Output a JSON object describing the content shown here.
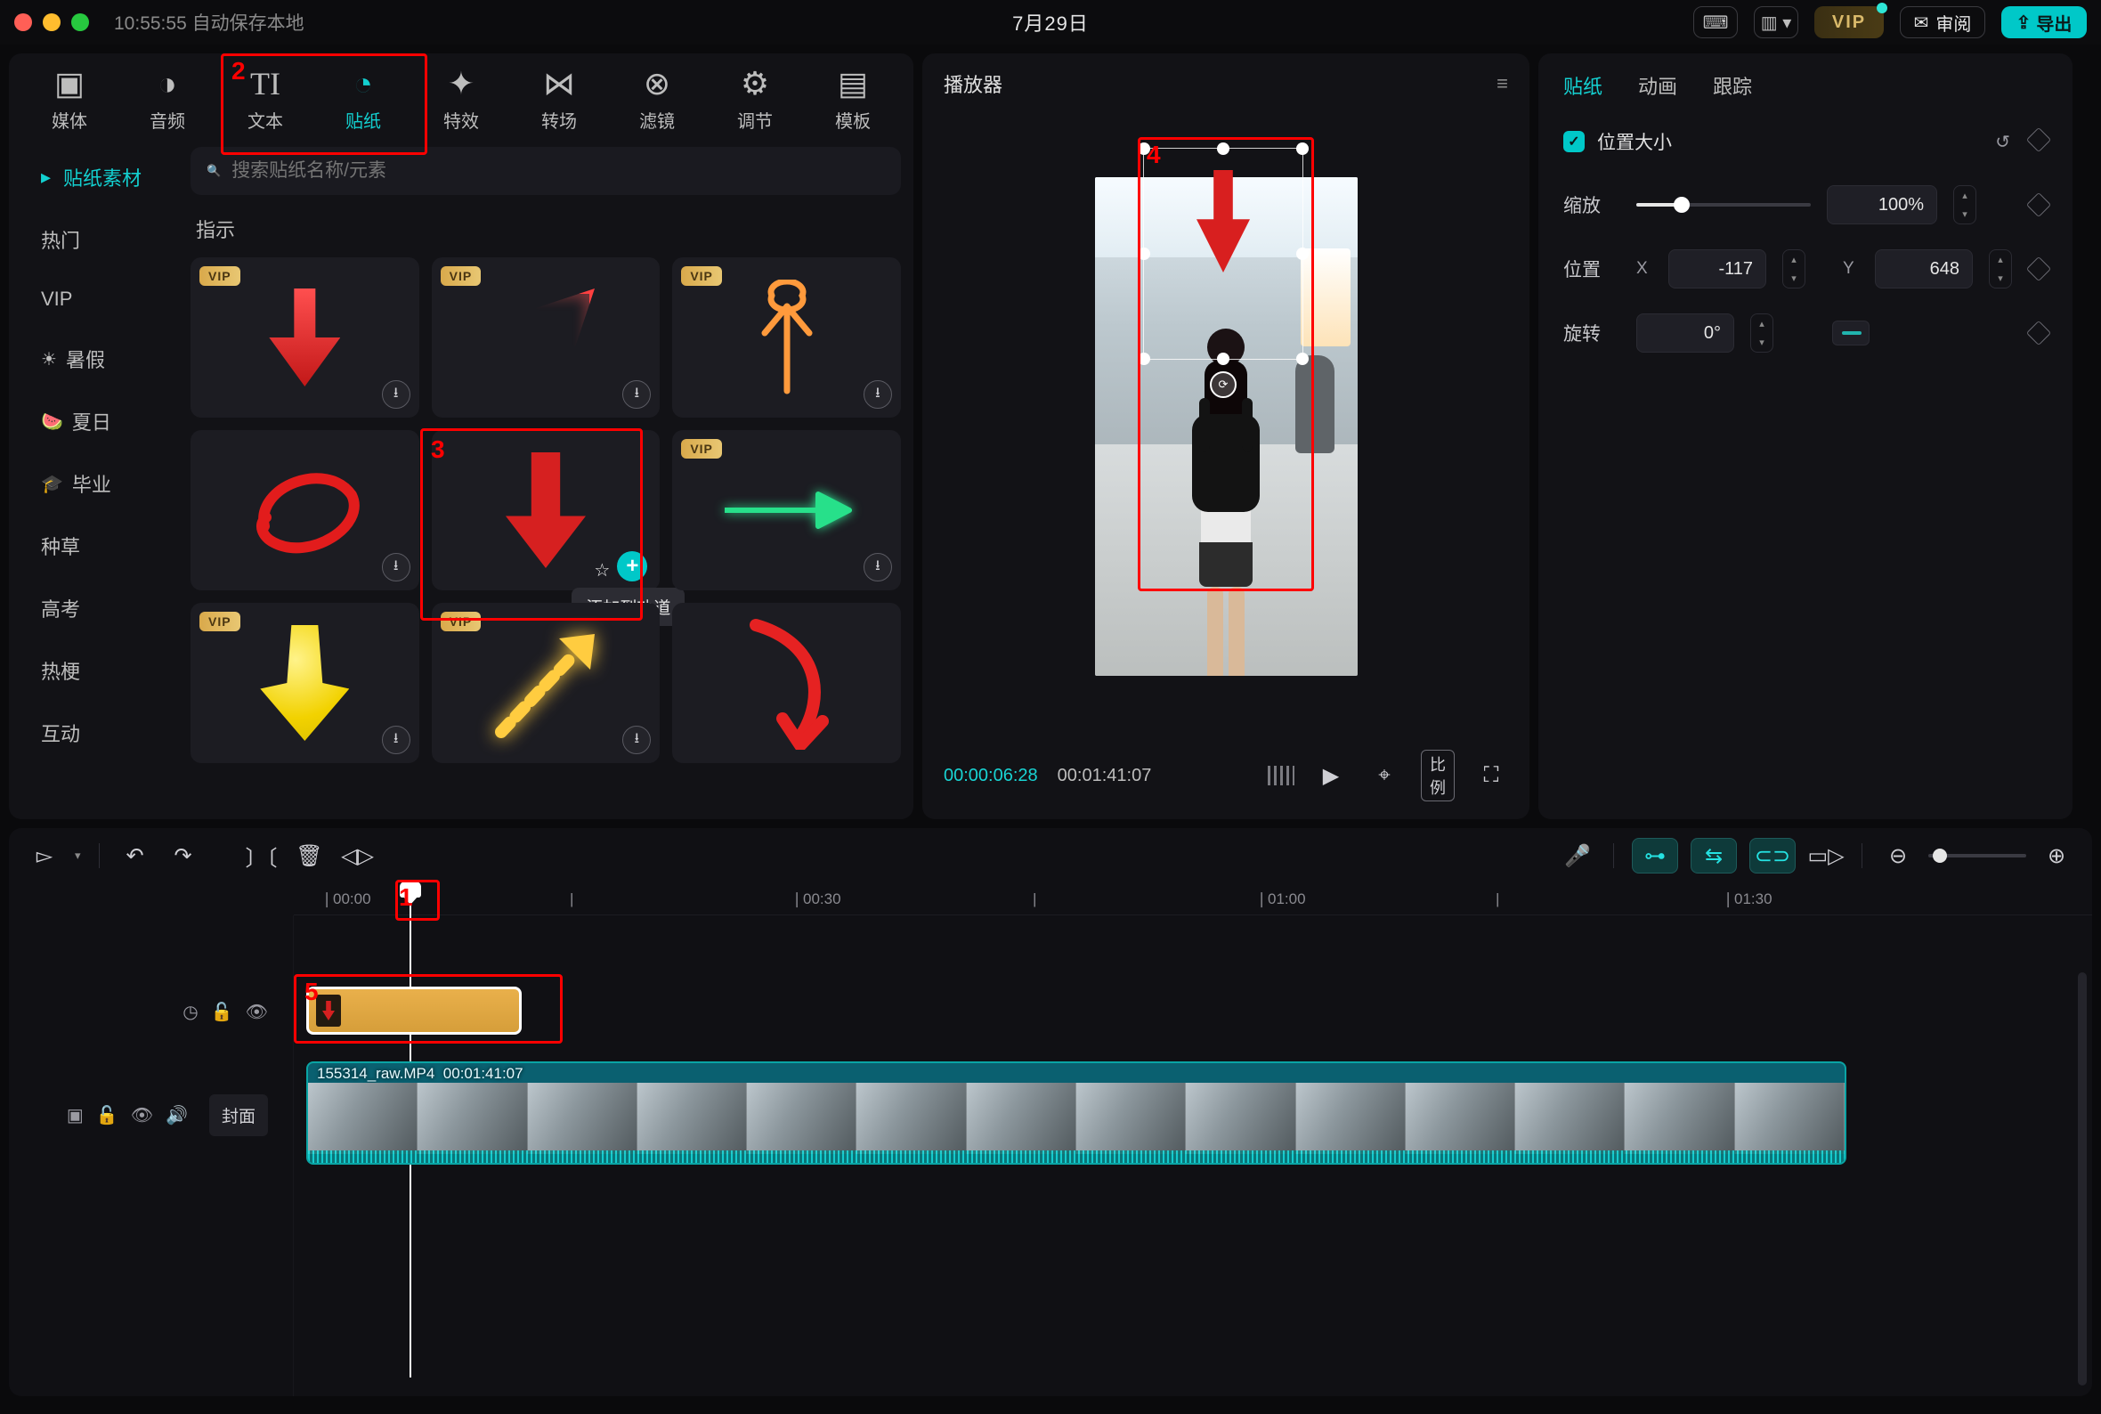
{
  "titlebar": {
    "autosave_text": "10:55:55 自动保存本地",
    "project_title": "7月29日",
    "vip_label": "VIP",
    "review_label": "审阅",
    "export_label": "导出"
  },
  "top_tabs": [
    {
      "id": "media",
      "label": "媒体"
    },
    {
      "id": "audio",
      "label": "音频"
    },
    {
      "id": "text",
      "label": "文本"
    },
    {
      "id": "sticker",
      "label": "贴纸"
    },
    {
      "id": "effect",
      "label": "特效"
    },
    {
      "id": "transition",
      "label": "转场"
    },
    {
      "id": "filter",
      "label": "滤镜"
    },
    {
      "id": "adjust",
      "label": "调节"
    },
    {
      "id": "template",
      "label": "模板"
    }
  ],
  "search": {
    "placeholder": "搜索贴纸名称/元素"
  },
  "categories": [
    {
      "id": "material",
      "label": "贴纸素材",
      "active": true
    },
    {
      "id": "hot",
      "label": "热门"
    },
    {
      "id": "vip",
      "label": "VIP"
    },
    {
      "id": "summer",
      "label": "暑假",
      "emoji": "☀"
    },
    {
      "id": "summer2",
      "label": "夏日",
      "emoji": "🍉"
    },
    {
      "id": "grad",
      "label": "毕业",
      "emoji": "🎓"
    },
    {
      "id": "seed",
      "label": "种草"
    },
    {
      "id": "exam",
      "label": "高考"
    },
    {
      "id": "meme",
      "label": "热梗"
    },
    {
      "id": "interact",
      "label": "互动"
    }
  ],
  "section_title": "指示",
  "stickers": [
    {
      "vip": true,
      "shape": "red-arrow-down"
    },
    {
      "vip": true,
      "shape": "neon-arrow"
    },
    {
      "vip": true,
      "shape": "line-arrow-up"
    },
    {
      "vip": false,
      "shape": "red-circle"
    },
    {
      "vip": false,
      "shape": "thick-arrow-down",
      "selected": true
    },
    {
      "vip": true,
      "shape": "green-arrow"
    },
    {
      "vip": true,
      "shape": "yellow-bulb"
    },
    {
      "vip": true,
      "shape": "gold-dotted"
    },
    {
      "vip": false,
      "shape": "red-curve"
    }
  ],
  "tooltip_add_track": "添加到轨道",
  "player": {
    "title": "播放器",
    "current_time": "00:00:06:28",
    "total_time": "00:01:41:07",
    "ratio_label": "比例"
  },
  "inspector": {
    "tabs": {
      "sticker": "贴纸",
      "anim": "动画",
      "track": "跟踪"
    },
    "section": "位置大小",
    "scale_label": "缩放",
    "scale_value": "100%",
    "pos_label": "位置",
    "x_label": "X",
    "x_value": "-117",
    "y_label": "Y",
    "y_value": "648",
    "rot_label": "旋转",
    "rot_value": "0°"
  },
  "timeline": {
    "ticks": [
      "00:00",
      "|",
      "00:30",
      "|",
      "01:00",
      "|",
      "01:30"
    ],
    "clip_name": "155314_raw.MP4",
    "clip_dur": "00:01:41:07",
    "cover_label": "封面"
  },
  "annotations": {
    "n1": "1",
    "n2": "2",
    "n3": "3",
    "n4": "4",
    "n5": "5"
  }
}
